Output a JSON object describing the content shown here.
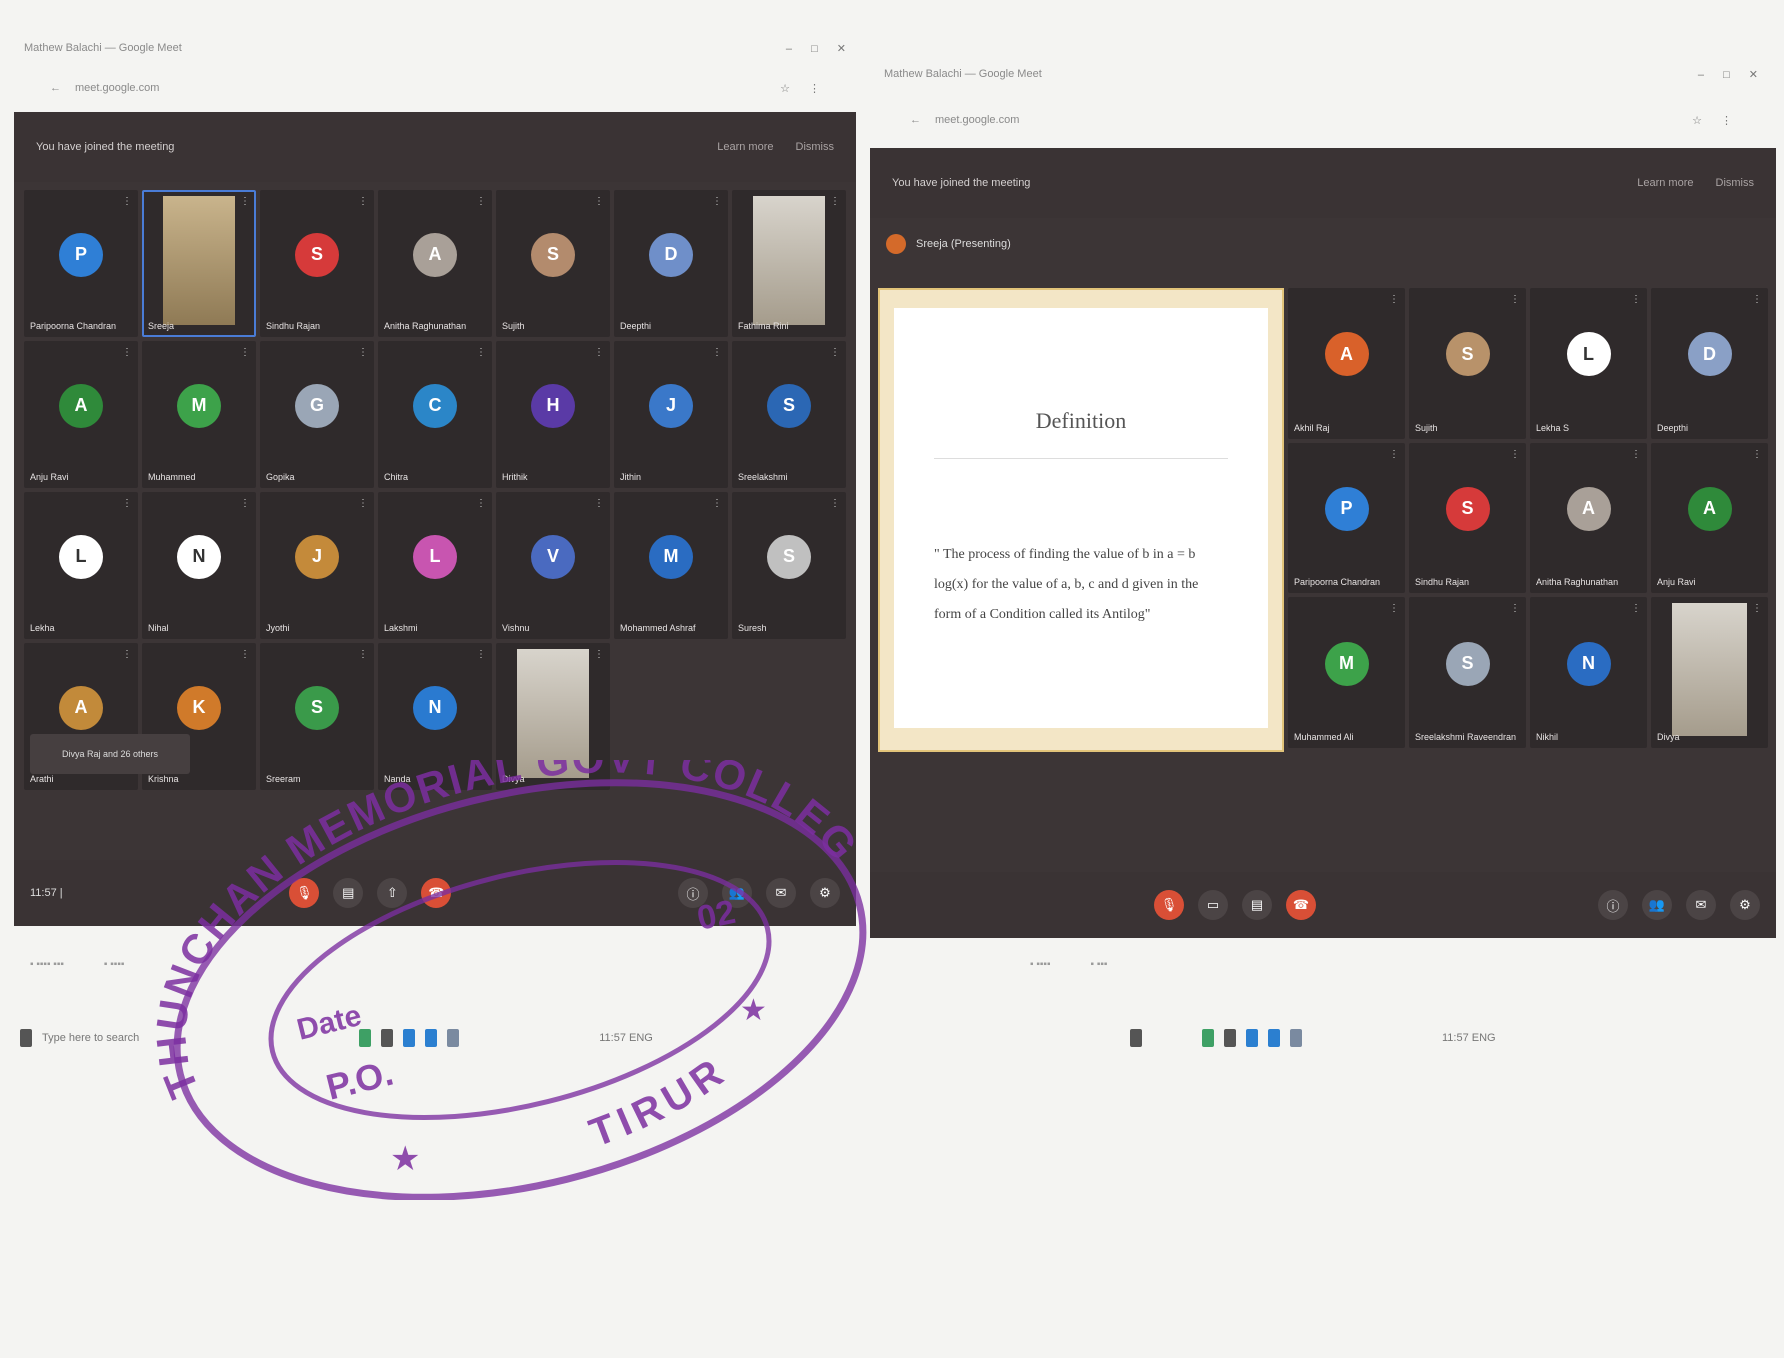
{
  "windows": [
    {
      "tab_text": "Mathew Balachi — Google Meet",
      "address_text": "meet.google.com",
      "banner_text": "You have joined the meeting",
      "banner_buttons": [
        "Learn more",
        "Dismiss"
      ],
      "time_text": "11:57  | ",
      "tiles": [
        {
          "name": "Paripoorna Chandran",
          "initial": "P",
          "color": "#2f7fd6",
          "type": "avatar"
        },
        {
          "name": "Sreeja",
          "initial": "",
          "color": "",
          "type": "photo",
          "selected": true
        },
        {
          "name": "Sindhu Rajan",
          "initial": "S",
          "color": "#d63a3a",
          "type": "avatar"
        },
        {
          "name": "Anitha Raghunathan",
          "initial": "A",
          "color": "#a9a098",
          "type": "avatar"
        },
        {
          "name": "Sujith",
          "initial": "S",
          "color": "#b38b6d",
          "type": "avatar"
        },
        {
          "name": "Deepthi",
          "initial": "D",
          "color": "#6f8fc9",
          "type": "avatar"
        },
        {
          "name": "Fathima Rini",
          "initial": "",
          "color": "",
          "type": "photo2"
        },
        {
          "name": "Anju Ravi",
          "initial": "A",
          "color": "#2f8a3a",
          "type": "avatar"
        },
        {
          "name": "Muhammed",
          "initial": "M",
          "color": "#3da24a",
          "type": "avatar"
        },
        {
          "name": "Gopika",
          "initial": "G",
          "color": "#9aa6b6",
          "type": "avatar"
        },
        {
          "name": "Chitra",
          "initial": "C",
          "color": "#2b86c8",
          "type": "avatar"
        },
        {
          "name": "Hrithik",
          "initial": "H",
          "color": "#5a3aa6",
          "type": "avatar"
        },
        {
          "name": "Jithin",
          "initial": "J",
          "color": "#3a78c9",
          "type": "avatar"
        },
        {
          "name": "Sreelakshmi",
          "initial": "S",
          "color": "#2b67b4",
          "type": "avatar"
        },
        {
          "name": "Lekha",
          "initial": "L",
          "color": "#ffffff",
          "type": "avatar"
        },
        {
          "name": "Nihal",
          "initial": "N",
          "color": "#ffffff",
          "type": "avatar"
        },
        {
          "name": "Jyothi",
          "initial": "J",
          "color": "#c48a3a",
          "type": "avatar"
        },
        {
          "name": "Lakshmi",
          "initial": "L",
          "color": "#c855b0",
          "type": "avatar"
        },
        {
          "name": "Vishnu",
          "initial": "V",
          "color": "#4a6ac0",
          "type": "avatar"
        },
        {
          "name": "Mohammed Ashraf",
          "initial": "M",
          "color": "#2a6cc2",
          "type": "avatar"
        },
        {
          "name": "Suresh",
          "initial": "S",
          "color": "#c0c0c0",
          "type": "avatar"
        },
        {
          "name": "Arathi",
          "initial": "A",
          "color": "#c28a3a",
          "type": "avatar"
        },
        {
          "name": "Krishna",
          "initial": "K",
          "color": "#d07a2a",
          "type": "avatar"
        },
        {
          "name": "Sreeram",
          "initial": "S",
          "color": "#3a9a4a",
          "type": "avatar"
        },
        {
          "name": "Nanda",
          "initial": "N",
          "color": "#2a7ad0",
          "type": "avatar"
        },
        {
          "name": "Divya",
          "initial": "",
          "color": "",
          "type": "photo2"
        }
      ],
      "bottom_left_note": "Divya Raj and 26 others"
    },
    {
      "tab_text": "Mathew Balachi — Google Meet",
      "address_text": "meet.google.com",
      "banner_text": "You have joined the meeting",
      "banner_buttons": [
        "Learn more",
        "Dismiss"
      ],
      "present_note": "Sreeja (Presenting)",
      "slide_title": "Definition",
      "slide_body": "\" The process of finding the value of b in a = b log(x) for the value of a, b, c and d given in the form of a Condition called its Antilog\"",
      "tiles": [
        {
          "name": "Akhil Raj",
          "initial": "A",
          "color": "#d9612a",
          "type": "avatar"
        },
        {
          "name": "Sujith",
          "initial": "S",
          "color": "#b8926a",
          "type": "avatar"
        },
        {
          "name": "Lekha S",
          "initial": "L",
          "color": "#ffffff",
          "type": "avatar"
        },
        {
          "name": "Deepthi",
          "initial": "D",
          "color": "#8aa0c6",
          "type": "avatar"
        },
        {
          "name": "Paripoorna Chandran",
          "initial": "P",
          "color": "#2f7fd6",
          "type": "avatar"
        },
        {
          "name": "Sindhu Rajan",
          "initial": "S",
          "color": "#d63a3a",
          "type": "avatar"
        },
        {
          "name": "Anitha Raghunathan",
          "initial": "A",
          "color": "#a9a098",
          "type": "avatar"
        },
        {
          "name": "Anju Ravi",
          "initial": "A",
          "color": "#2f8a3a",
          "type": "avatar"
        },
        {
          "name": "Muhammed Ali",
          "initial": "M",
          "color": "#3da24a",
          "type": "avatar"
        },
        {
          "name": "Sreelakshmi Raveendran",
          "initial": "S",
          "color": "#9aa6b6",
          "type": "avatar"
        },
        {
          "name": "Nikhil",
          "initial": "N",
          "color": "#2a6cc2",
          "type": "avatar"
        },
        {
          "name": "Divya",
          "initial": "",
          "color": "",
          "type": "photo2"
        }
      ]
    }
  ],
  "taskbar": {
    "left_text": "Type here to search",
    "right_text": "11:57  ENG"
  },
  "stamp": {
    "top_text": "THUNCHAN MEMORIAL GOVT COLLEGE",
    "pin": "02",
    "date_label": "Date",
    "po_label": "P.O.",
    "bottom_text": "TIRUR"
  }
}
